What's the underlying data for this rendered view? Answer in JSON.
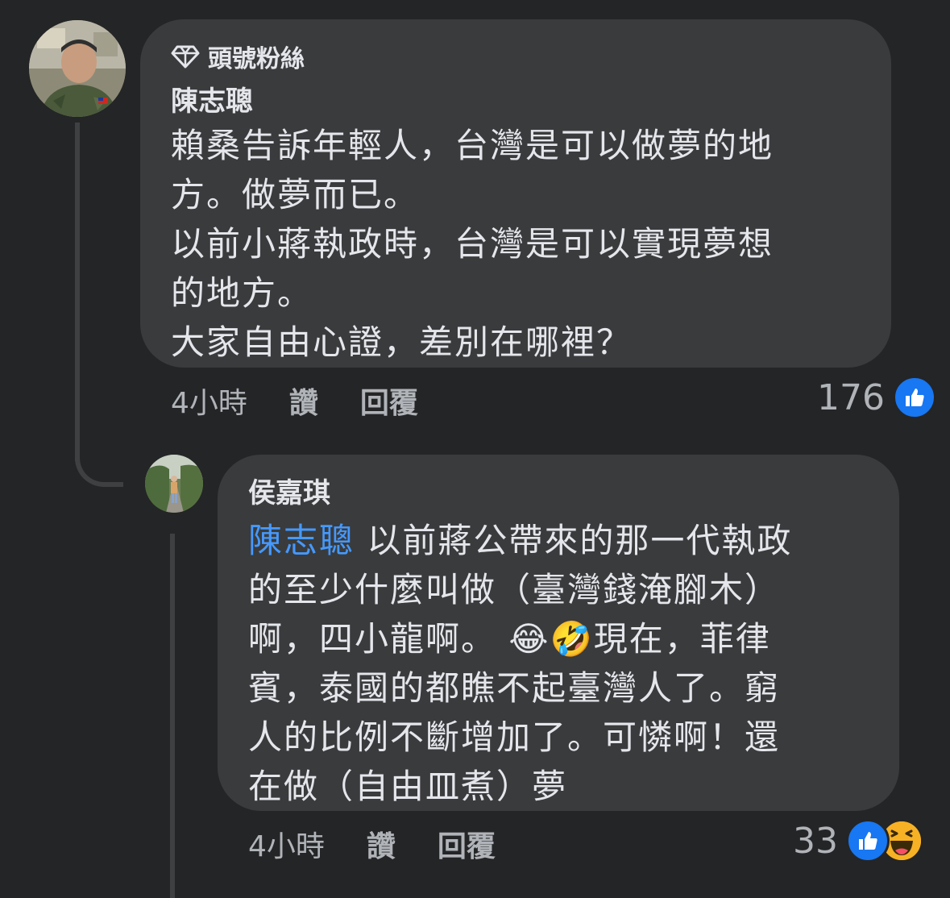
{
  "comment": {
    "badge": "頭號粉絲",
    "badge_icon": "diamond-icon",
    "author": "陳志聰",
    "text": "賴桑告訴年輕人，台灣是可以做夢的地\n方。做夢而已。\n以前小蔣執政時，台灣是可以實現夢想\n的地方。\n大家自由心證，差別在哪裡？",
    "time": "4小時",
    "like_label": "讚",
    "reply_label": "回覆",
    "reaction_count": "176",
    "reactions": [
      "like-reaction-icon"
    ]
  },
  "reply": {
    "author": "侯嘉琪",
    "mention": "陳志聰",
    "text_part1": " 以前蔣公帶來的那一代執政\n的至少什麼叫做（臺灣錢淹腳木）\n啊，四小龍啊。 ",
    "emoji1": "😂",
    "emoji2": "🤣",
    "text_part2": "現在，菲律\n賓，泰國的都瞧不起臺灣人了。窮\n人的比例不斷增加了。可憐啊！還\n在做（自由皿煮）夢",
    "time": "4小時",
    "like_label": "讚",
    "reply_label": "回覆",
    "reaction_count": "33",
    "reactions": [
      "like-reaction-icon",
      "haha-reaction-icon"
    ]
  },
  "colors": {
    "background": "#242526",
    "bubble": "#3a3b3c",
    "text": "#e4e6eb",
    "secondary_text": "#b0b3b8",
    "mention": "#4599ff",
    "like_blue": "#1877f2",
    "haha_yellow": "#f7b125"
  }
}
